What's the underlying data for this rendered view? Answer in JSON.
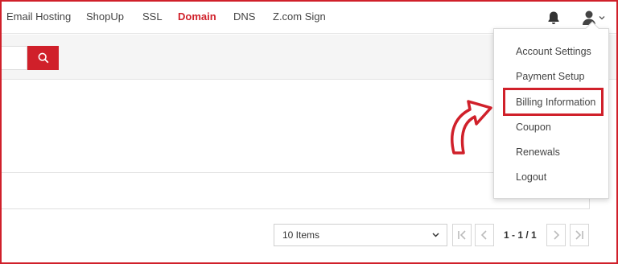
{
  "nav": {
    "items": [
      {
        "label": "Email Hosting",
        "active": false
      },
      {
        "label": "ShopUp",
        "active": false
      },
      {
        "label": "SSL",
        "active": false
      },
      {
        "label": "Domain",
        "active": true
      },
      {
        "label": "DNS",
        "active": false
      },
      {
        "label": "Z.com Sign",
        "active": false
      }
    ],
    "icons": {
      "notifications": "bell-icon",
      "account": "user-icon",
      "account_caret": "chevron-down-icon"
    }
  },
  "search": {
    "value": "",
    "button_icon": "search-icon"
  },
  "account_menu": {
    "items": [
      {
        "label": "Account Settings"
      },
      {
        "label": "Payment Setup"
      },
      {
        "label": "Billing Information"
      },
      {
        "label": "Coupon"
      },
      {
        "label": "Renewals"
      },
      {
        "label": "Logout"
      }
    ],
    "highlighted": "Billing Information"
  },
  "pagination": {
    "page_size": "10 Items",
    "page_info": "1 - 1 / 1",
    "icons": [
      "first-page-icon",
      "prev-page-icon",
      "next-page-icon",
      "last-page-icon"
    ]
  },
  "colors": {
    "accent": "#d0202a",
    "nav_text": "#444444",
    "border": "#d8d8d8"
  }
}
